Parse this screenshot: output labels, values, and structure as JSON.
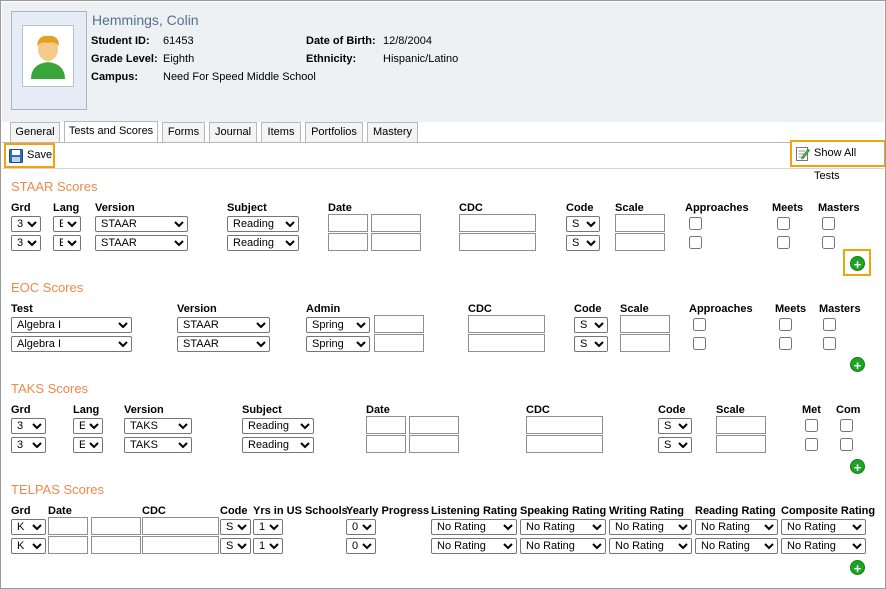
{
  "student": {
    "name": "Hemmings, Colin",
    "id_label": "Student ID:",
    "id": "61453",
    "grade_label": "Grade Level:",
    "grade": "Eighth",
    "campus_label": "Campus:",
    "campus": "Need For Speed Middle School",
    "dob_label": "Date of Birth:",
    "dob": "12/8/2004",
    "ethnicity_label": "Ethnicity:",
    "ethnicity": "Hispanic/Latino"
  },
  "tabs": [
    "General",
    "Tests and Scores",
    "Forms",
    "Journal",
    "Items",
    "Portfolios",
    "Mastery"
  ],
  "active_tab": "Tests and Scores",
  "toolbar": {
    "save_label": "Save",
    "show_all_label": "Show All Tests"
  },
  "colors": {
    "section_title": "#f0884a",
    "highlight": "#f0a30a",
    "add_button": "#1ea325",
    "header_bg": "#eef1f4"
  },
  "staar": {
    "title": "STAAR Scores",
    "headers": {
      "grd": "Grd",
      "lang": "Lang",
      "version": "Version",
      "subject": "Subject",
      "date": "Date",
      "cdc": "CDC",
      "code": "Code",
      "scale": "Scale",
      "approaches": "Approaches",
      "meets": "Meets",
      "masters": "Masters"
    },
    "rows": [
      {
        "grd": "3",
        "lang": "E",
        "version": "STAAR",
        "subject": "Reading",
        "code": "S"
      },
      {
        "grd": "3",
        "lang": "E",
        "version": "STAAR",
        "subject": "Reading",
        "code": "S"
      }
    ]
  },
  "eoc": {
    "title": "EOC Scores",
    "headers": {
      "test": "Test",
      "version": "Version",
      "admin": "Admin",
      "cdc": "CDC",
      "code": "Code",
      "scale": "Scale",
      "approaches": "Approaches",
      "meets": "Meets",
      "masters": "Masters"
    },
    "rows": [
      {
        "test": "Algebra I",
        "version": "STAAR",
        "admin": "Spring",
        "code": "S"
      },
      {
        "test": "Algebra I",
        "version": "STAAR",
        "admin": "Spring",
        "code": "S"
      }
    ]
  },
  "taks": {
    "title": "TAKS Scores",
    "headers": {
      "grd": "Grd",
      "lang": "Lang",
      "version": "Version",
      "subject": "Subject",
      "date": "Date",
      "cdc": "CDC",
      "code": "Code",
      "scale": "Scale",
      "met": "Met",
      "com": "Com"
    },
    "rows": [
      {
        "grd": "3",
        "lang": "E",
        "version": "TAKS",
        "subject": "Reading",
        "code": "S"
      },
      {
        "grd": "3",
        "lang": "E",
        "version": "TAKS",
        "subject": "Reading",
        "code": "S"
      }
    ]
  },
  "telpas": {
    "title": "TELPAS Scores",
    "headers": {
      "grd": "Grd",
      "date": "Date",
      "cdc": "CDC",
      "code": "Code",
      "yrs": "Yrs in US Schools",
      "yearly": "Yearly Progress",
      "listening": "Listening Rating",
      "speaking": "Speaking Rating",
      "writing": "Writing Rating",
      "reading": "Reading Rating",
      "composite": "Composite Rating"
    },
    "rows": [
      {
        "grd": "K",
        "code": "S",
        "yrs": "1",
        "yearly": "0",
        "listening": "No Rating",
        "speaking": "No Rating",
        "writing": "No Rating",
        "reading": "No Rating",
        "composite": "No Rating"
      },
      {
        "grd": "K",
        "code": "S",
        "yrs": "1",
        "yearly": "0",
        "listening": "No Rating",
        "speaking": "No Rating",
        "writing": "No Rating",
        "reading": "No Rating",
        "composite": "No Rating"
      }
    ]
  },
  "icons": {
    "save": "floppy-disk-icon",
    "show_all": "document-edit-icon",
    "add": "plus-circle-icon",
    "avatar": "user-silhouette-icon"
  }
}
